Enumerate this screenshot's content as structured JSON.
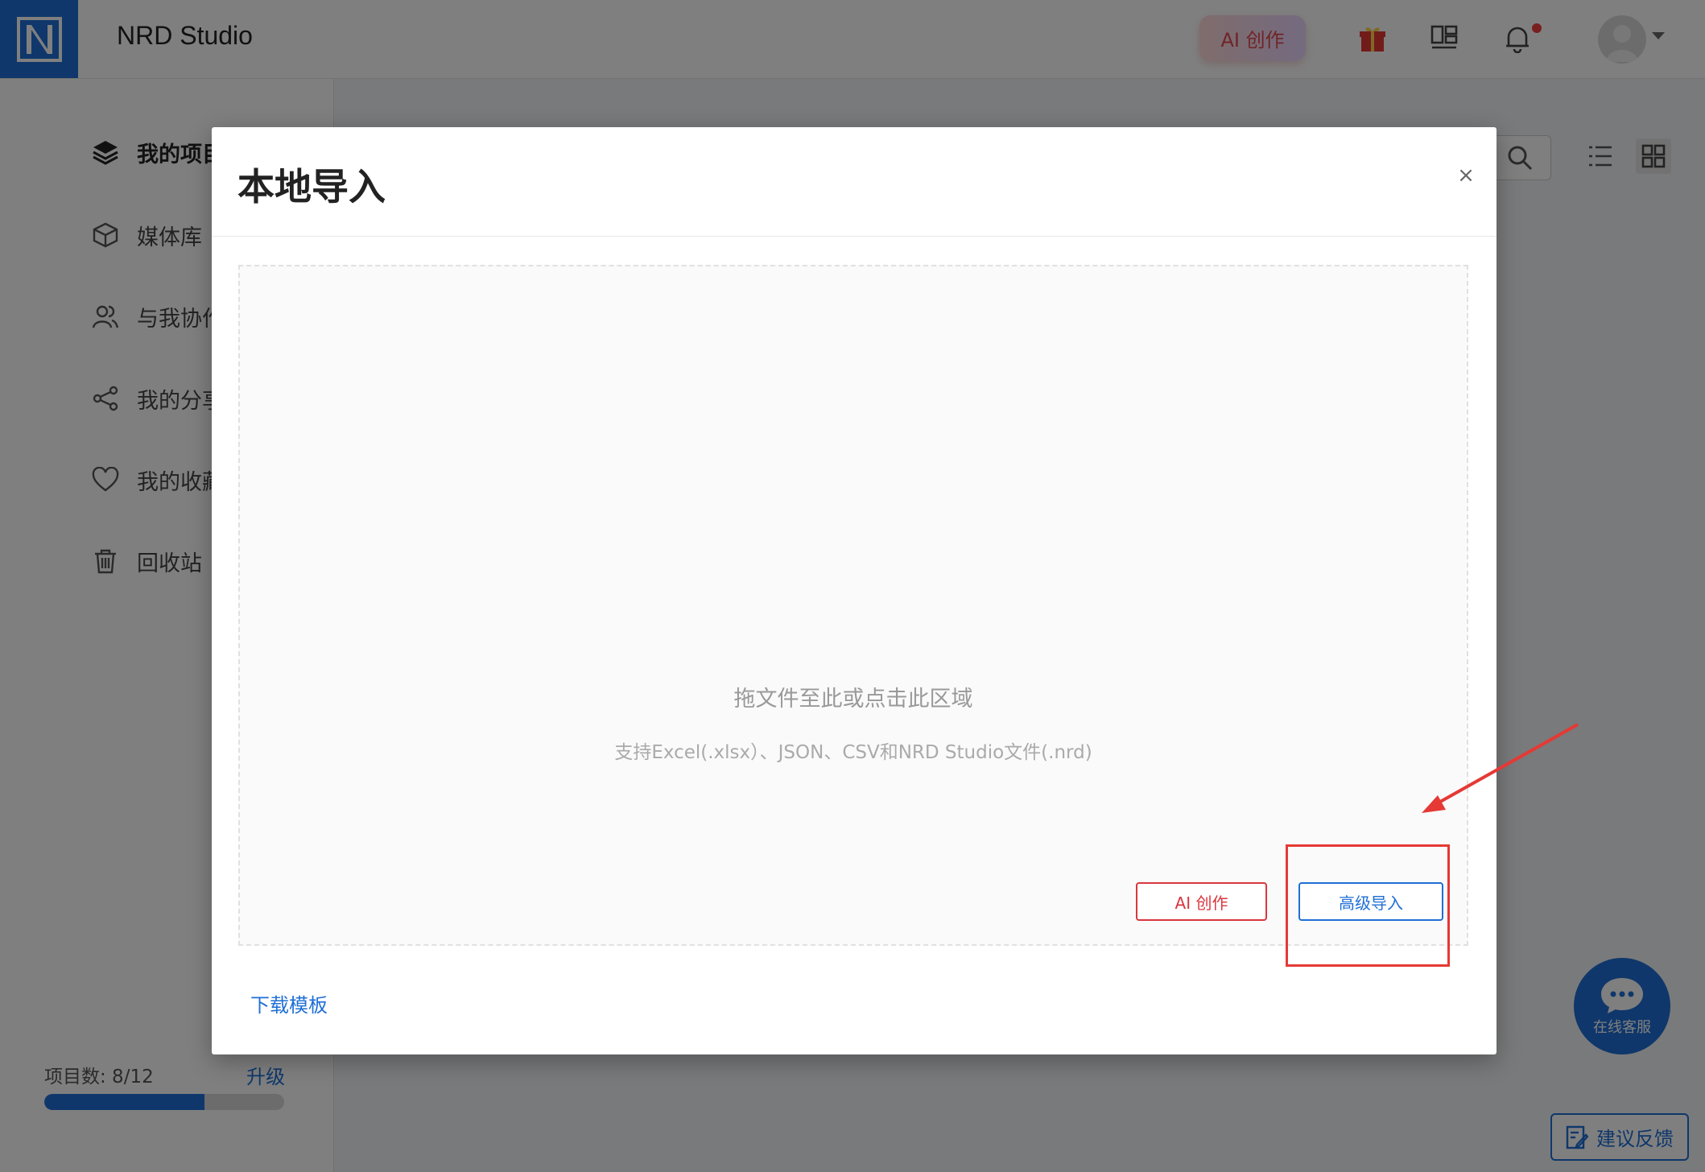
{
  "app": {
    "title": "NRD Studio",
    "logo_letter": "N",
    "brand_color": "#1f6fd6",
    "ai_button_label": "AI 创作",
    "top_icons": [
      "gift-icon",
      "layout-icon",
      "bell-icon"
    ]
  },
  "sidebar": {
    "items": [
      {
        "label": "我的项目",
        "icon": "layers-icon"
      },
      {
        "label": "媒体库",
        "icon": "cube-icon"
      },
      {
        "label": "与我协作",
        "icon": "users-icon"
      },
      {
        "label": "我的分享",
        "icon": "share-icon"
      },
      {
        "label": "我的收藏",
        "icon": "heart-icon"
      },
      {
        "label": "回收站",
        "icon": "trash-icon"
      }
    ],
    "quota_label": "项目数: 8/12",
    "quota_fraction": 0.667,
    "upgrade_label": "升级"
  },
  "widgets": {
    "chat_label": "在线客服",
    "feedback_label": "建议反馈"
  },
  "modal": {
    "title": "本地导入",
    "close_glyph": "×",
    "drop_main": "拖文件至此或点击此区域",
    "drop_sub": "支持Excel(.xlsx）、JSON、CSV和NRD Studio文件(.nrd)",
    "ai_button": "AI 创作",
    "advanced_button": "高级导入",
    "download_link": "下载模板"
  },
  "annotation": {
    "highlight_color": "#e53935"
  }
}
